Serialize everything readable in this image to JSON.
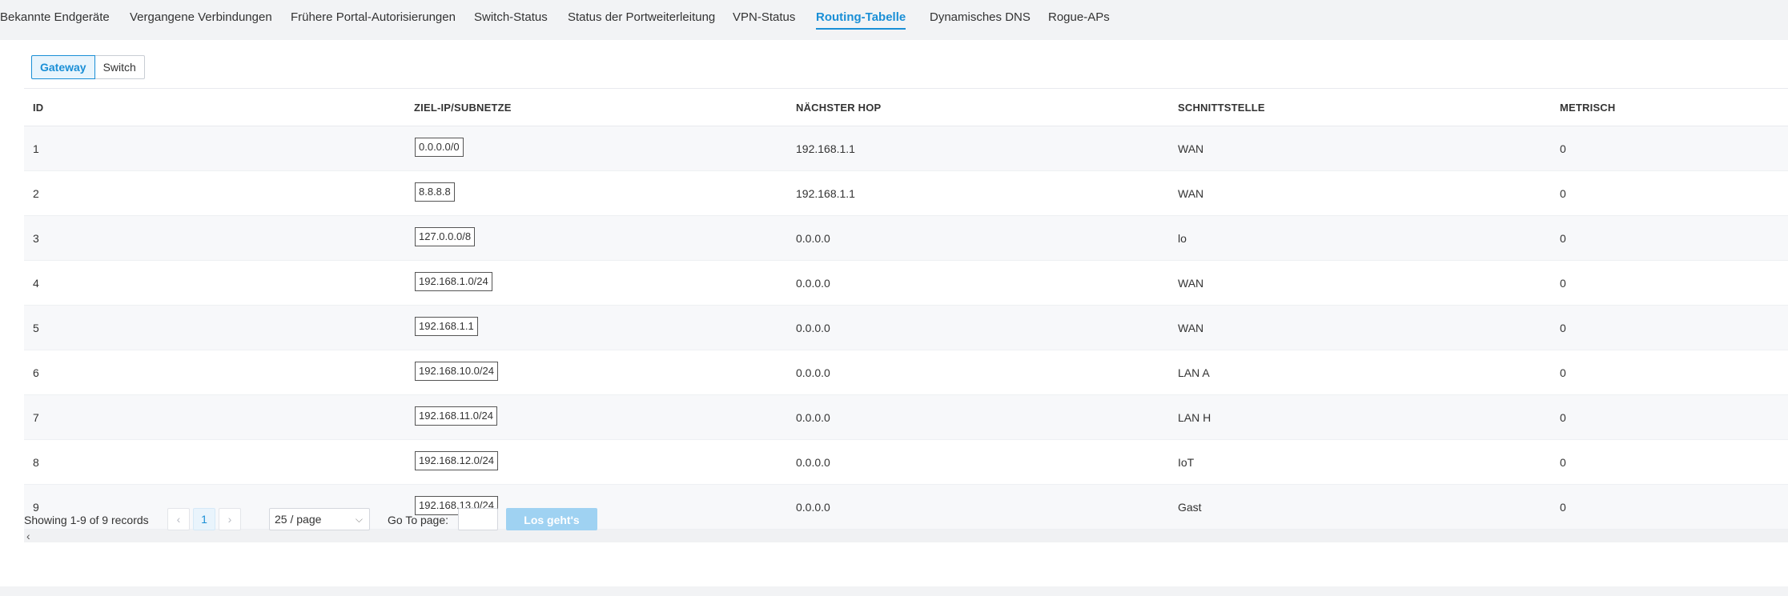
{
  "tabs": [
    {
      "label": "Bekannte Endgeräte",
      "active": false
    },
    {
      "label": "Vergangene Verbindungen",
      "active": false
    },
    {
      "label": "Frühere Portal-Autorisierungen",
      "active": false
    },
    {
      "label": "Switch-Status",
      "active": false
    },
    {
      "label": "Status der Portweiterleitung",
      "active": false
    },
    {
      "label": "VPN-Status",
      "active": false
    },
    {
      "label": "Routing-Tabelle",
      "active": true
    },
    {
      "label": "Dynamisches DNS",
      "active": false
    },
    {
      "label": "Rogue-APs",
      "active": false
    }
  ],
  "toggle": {
    "gateway_label": "Gateway",
    "switch_label": "Switch",
    "selected": "Gateway"
  },
  "table": {
    "headers": {
      "id": "ID",
      "dest": "ZIEL-IP/SUBNETZE",
      "next_hop": "NÄCHSTER HOP",
      "interface": "SCHNITTSTELLE",
      "metric": "METRISCH"
    },
    "rows": [
      {
        "id": "1",
        "dest": "0.0.0.0/0",
        "next_hop": "192.168.1.1",
        "interface": "WAN",
        "metric": "0"
      },
      {
        "id": "2",
        "dest": "8.8.8.8",
        "next_hop": "192.168.1.1",
        "interface": "WAN",
        "metric": "0"
      },
      {
        "id": "3",
        "dest": "127.0.0.0/8",
        "next_hop": "0.0.0.0",
        "interface": "lo",
        "metric": "0"
      },
      {
        "id": "4",
        "dest": "192.168.1.0/24",
        "next_hop": "0.0.0.0",
        "interface": "WAN",
        "metric": "0"
      },
      {
        "id": "5",
        "dest": "192.168.1.1",
        "next_hop": "0.0.0.0",
        "interface": "WAN",
        "metric": "0"
      },
      {
        "id": "6",
        "dest": "192.168.10.0/24",
        "next_hop": "0.0.0.0",
        "interface": "LAN A",
        "metric": "0"
      },
      {
        "id": "7",
        "dest": "192.168.11.0/24",
        "next_hop": "0.0.0.0",
        "interface": "LAN H",
        "metric": "0"
      },
      {
        "id": "8",
        "dest": "192.168.12.0/24",
        "next_hop": "0.0.0.0",
        "interface": "IoT",
        "metric": "0"
      },
      {
        "id": "9",
        "dest": "192.168.13.0/24",
        "next_hop": "0.0.0.0",
        "interface": "Gast",
        "metric": "0"
      }
    ]
  },
  "pagination": {
    "records_text": "Showing 1-9 of 9 records",
    "prev_icon": "‹",
    "current_page": "1",
    "next_icon": "›",
    "page_size": "25 / page",
    "goto_label": "Go To page:",
    "goto_value": "",
    "go_button": "Los geht's"
  },
  "icons": {
    "scroll_left": "‹",
    "chevron_down": "⌵"
  },
  "colors": {
    "accent": "#1a8fd6",
    "go_button_disabled": "#9fd2f2"
  }
}
